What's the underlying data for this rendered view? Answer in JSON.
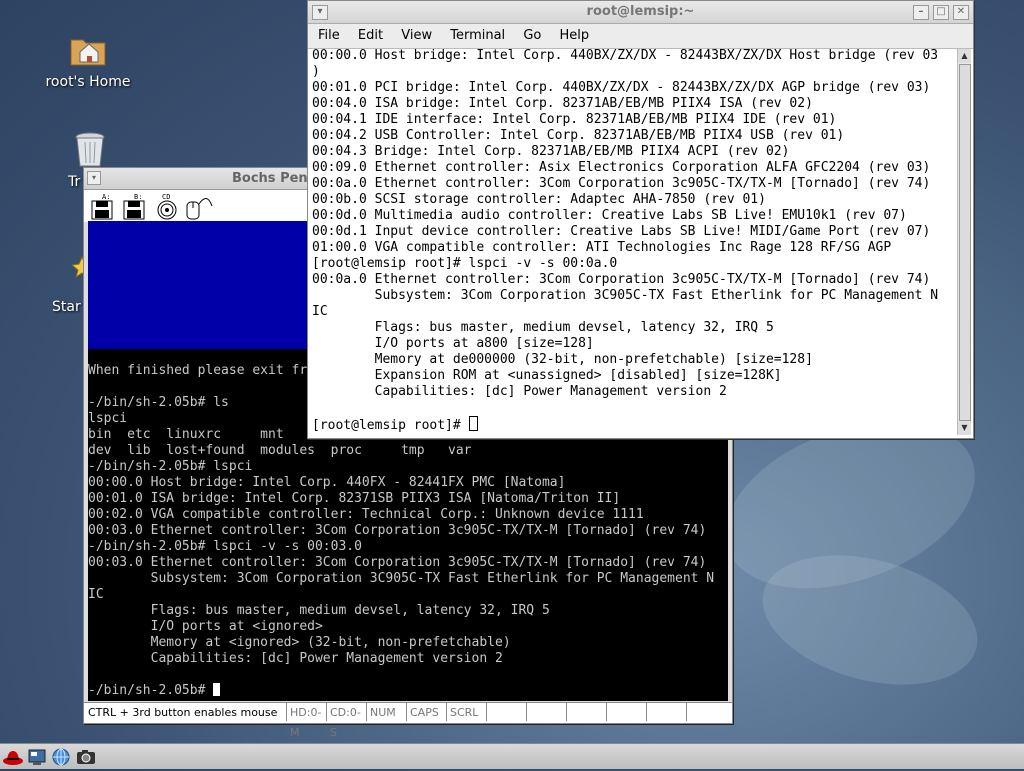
{
  "desktop": {
    "icons": [
      {
        "label": "root's Home",
        "icon": "home-folder-icon"
      },
      {
        "label": "Tr",
        "icon": "trash-icon"
      },
      {
        "label": "Star",
        "icon": "start-here-icon"
      }
    ]
  },
  "bochs": {
    "title": "Bochs Penti",
    "screen_lines": "When finished please exit fr\n\n-/bin/sh-2.05b# ls\nlspci\nbin  etc  linuxrc     mnt\ndev  lib  lost+found  modules  proc     tmp   var\n-/bin/sh-2.05b# lspci\n00:00.0 Host bridge: Intel Corp. 440FX - 82441FX PMC [Natoma]\n00:01.0 ISA bridge: Intel Corp. 82371SB PIIX3 ISA [Natoma/Triton II]\n00:02.0 VGA compatible controller: Technical Corp.: Unknown device 1111\n00:03.0 Ethernet controller: 3Com Corporation 3c905C-TX/TX-M [Tornado] (rev 74)\n-/bin/sh-2.05b# lspci -v -s 00:03.0\n00:03.0 Ethernet controller: 3Com Corporation 3c905C-TX/TX-M [Tornado] (rev 74)\n        Subsystem: 3Com Corporation 3C905C-TX Fast Etherlink for PC Management N\nIC\n        Flags: bus master, medium devsel, latency 32, IRQ 5\n        I/O ports at <ignored>\n        Memory at <ignored> (32-bit, non-prefetchable)\n        Capabilities: [dc] Power Management version 2\n\n-/bin/sh-2.05b# ",
    "status": {
      "hint": "CTRL + 3rd button enables mouse",
      "hd": "HD:0-M",
      "cd": "CD:0-S",
      "num": "NUM",
      "caps": "CAPS",
      "scrl": "SCRL"
    }
  },
  "terminal": {
    "title": "root@lemsip:~",
    "menu": [
      "File",
      "Edit",
      "View",
      "Terminal",
      "Go",
      "Help"
    ],
    "output": "00:00.0 Host bridge: Intel Corp. 440BX/ZX/DX - 82443BX/ZX/DX Host bridge (rev 03\n)\n00:01.0 PCI bridge: Intel Corp. 440BX/ZX/DX - 82443BX/ZX/DX AGP bridge (rev 03)\n00:04.0 ISA bridge: Intel Corp. 82371AB/EB/MB PIIX4 ISA (rev 02)\n00:04.1 IDE interface: Intel Corp. 82371AB/EB/MB PIIX4 IDE (rev 01)\n00:04.2 USB Controller: Intel Corp. 82371AB/EB/MB PIIX4 USB (rev 01)\n00:04.3 Bridge: Intel Corp. 82371AB/EB/MB PIIX4 ACPI (rev 02)\n00:09.0 Ethernet controller: Asix Electronics Corporation ALFA GFC2204 (rev 03)\n00:0a.0 Ethernet controller: 3Com Corporation 3c905C-TX/TX-M [Tornado] (rev 74)\n00:0b.0 SCSI storage controller: Adaptec AHA-7850 (rev 01)\n00:0d.0 Multimedia audio controller: Creative Labs SB Live! EMU10k1 (rev 07)\n00:0d.1 Input device controller: Creative Labs SB Live! MIDI/Game Port (rev 07)\n01:00.0 VGA compatible controller: ATI Technologies Inc Rage 128 RF/SG AGP\n[root@lemsip root]# lspci -v -s 00:0a.0\n00:0a.0 Ethernet controller: 3Com Corporation 3c905C-TX/TX-M [Tornado] (rev 74)\n        Subsystem: 3Com Corporation 3C905C-TX Fast Etherlink for PC Management N\nIC\n        Flags: bus master, medium devsel, latency 32, IRQ 5\n        I/O ports at a800 [size=128]\n        Memory at de000000 (32-bit, non-prefetchable) [size=128]\n        Expansion ROM at <unassigned> [disabled] [size=128K]\n        Capabilities: [dc] Power Management version 2\n",
    "prompt": "[root@lemsip root]# "
  },
  "panel": {
    "buttons": [
      "redhat-menu-icon",
      "desktop-icon",
      "network-icon",
      "camera-icon"
    ]
  }
}
